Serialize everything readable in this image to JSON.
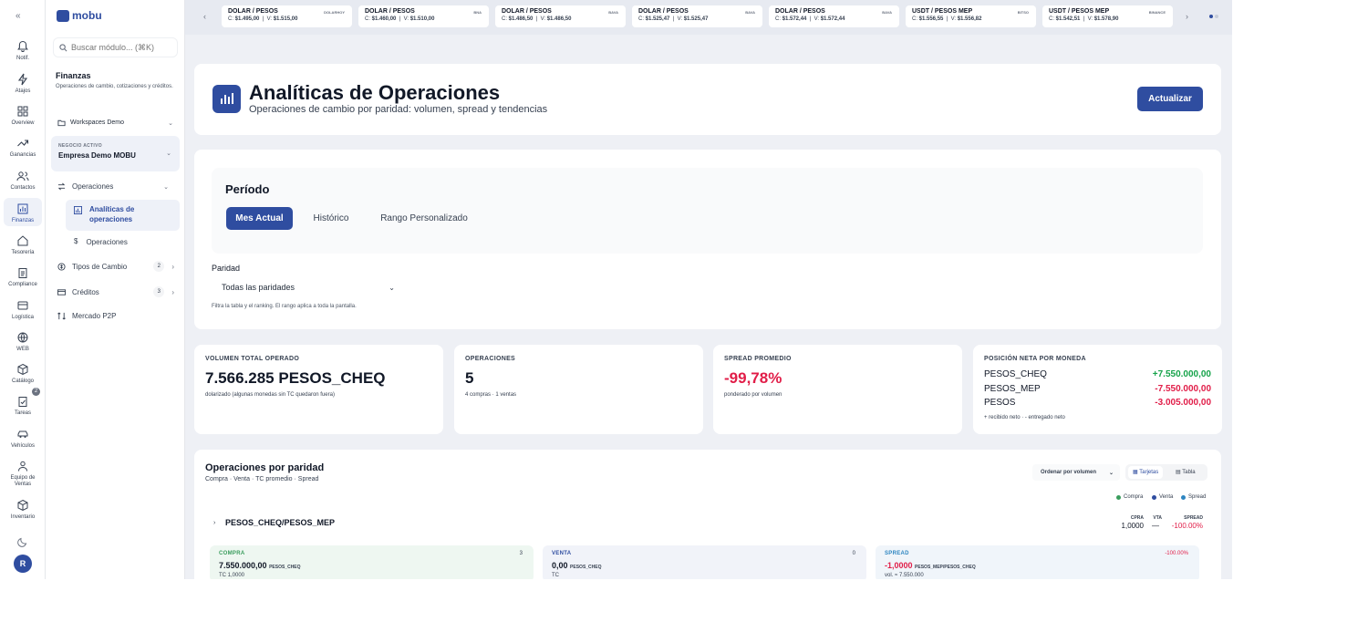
{
  "rail": {
    "collapse_icon": "double-chevron-left-icon",
    "items": [
      {
        "label": "Notif.",
        "icon": "bell-icon"
      },
      {
        "label": "Atajos",
        "icon": "lightning-icon"
      },
      {
        "label": "Overview",
        "icon": "grid-icon"
      },
      {
        "label": "Ganancias",
        "icon": "trend-icon"
      },
      {
        "label": "Contactos",
        "icon": "users-icon"
      },
      {
        "label": "Finanzas",
        "icon": "chart-icon"
      },
      {
        "label": "Tesorería",
        "icon": "home-icon"
      },
      {
        "label": "Compliance",
        "icon": "clipboard-icon"
      },
      {
        "label": "Logística",
        "icon": "box-icon"
      },
      {
        "label": "WEB",
        "icon": "globe-icon"
      },
      {
        "label": "Catálogo",
        "icon": "package-icon",
        "badge": "2"
      },
      {
        "label": "Tareas",
        "icon": "clipboard-check-icon"
      },
      {
        "label": "Vehículos",
        "icon": "car-icon"
      },
      {
        "label": "Equipo de Ventas",
        "icon": "team-icon"
      },
      {
        "label": "Inventario",
        "icon": "cube-icon"
      }
    ],
    "theme_icon": "moon-icon",
    "avatar": "R"
  },
  "sidebar": {
    "logo_text": "mobu",
    "search_placeholder": "Buscar módulo... (⌘K)",
    "section_title": "Finanzas",
    "section_desc": "Operaciones de cambio, cotizaciones y créditos.",
    "workspace": "Workspaces Demo",
    "business_label": "NEGOCIO ACTIVO",
    "business_name": "Empresa Demo MOBU",
    "nav_operaciones": "Operaciones",
    "sub_analiticas": "Analíticas de operaciones",
    "sub_operaciones": "Operaciones",
    "nav_tipos": "Tipos de Cambio",
    "nav_tipos_count": "2",
    "nav_creditos": "Créditos",
    "nav_creditos_count": "3",
    "nav_p2p": "Mercado P2P"
  },
  "ticker": [
    {
      "pair": "DOLAR / PESOS",
      "source": "DOLARHOY",
      "c": "$1.495,00",
      "v": "$1.515,00"
    },
    {
      "pair": "DOLAR / PESOS",
      "source": "BNA",
      "c": "$1.460,00",
      "v": "$1.510,00"
    },
    {
      "pair": "DOLAR / PESOS",
      "source": "BAVA",
      "c": "$1.486,50",
      "v": "$1.486,50"
    },
    {
      "pair": "DOLAR / PESOS",
      "source": "BAVA",
      "c": "$1.525,47",
      "v": "$1.525,47"
    },
    {
      "pair": "DOLAR / PESOS",
      "source": "BAVA",
      "c": "$1.572,44",
      "v": "$1.572,44"
    },
    {
      "pair": "USDT / PESOS MEP",
      "source": "BITSO",
      "c": "$1.556,55",
      "v": "$1.556,82"
    },
    {
      "pair": "USDT / PESOS MEP",
      "source": "BINANCE",
      "c": "$1.542,51",
      "v": "$1.578,90"
    }
  ],
  "header": {
    "title": "Analíticas de Operaciones",
    "subtitle": "Operaciones de cambio por paridad: volumen, spread y tendencias",
    "refresh_label": "Actualizar"
  },
  "filters": {
    "period_label": "Período",
    "periods": [
      "Mes Actual",
      "Histórico",
      "Rango Personalizado"
    ],
    "parity_label": "Paridad",
    "parity_value": "Todas las paridades",
    "note": "Filtra la tabla y el ranking. El rango aplica a toda la pantalla."
  },
  "stats": {
    "volume_label": "VOLUMEN TOTAL OPERADO",
    "volume_value": "7.566.285 PESOS_CHEQ",
    "volume_note": "dolarizado (algunas monedas sin TC quedaron fuera)",
    "ops_label": "OPERACIONES",
    "ops_value": "5",
    "ops_note": "4 compras · 1 ventas",
    "spread_label": "SPREAD PROMEDIO",
    "spread_value": "-99,78%",
    "spread_note": "ponderado por volumen",
    "position_label": "POSICIÓN NETA POR MONEDA",
    "positions": [
      {
        "currency": "PESOS_CHEQ",
        "amount": "+7.550.000,00"
      },
      {
        "currency": "PESOS_MEP",
        "amount": "-7.550.000,00"
      },
      {
        "currency": "PESOS",
        "amount": "-3.005.000,00"
      }
    ],
    "position_legend": "+ recibido neto · - entregado neto"
  },
  "ops": {
    "title": "Operaciones por paridad",
    "subtitle": "Compra · Venta · TC promedio · Spread",
    "sort_label": "Ordenar por volumen",
    "view_cards": "Tarjetas",
    "view_table": "Tabla",
    "legend": [
      "Compra",
      "Venta",
      "Spread"
    ],
    "pair": "PESOS_CHEQ/PESOS_MEP",
    "col_cpra": "CPRA",
    "col_cpra_val": "1,0000",
    "col_vta": "VTA",
    "col_vta_val": "—",
    "col_spread": "SPREAD",
    "col_spread_val": "-100.00%",
    "compra_label": "COMPRA",
    "compra_count": "3",
    "compra_amount": "7.550.000,00",
    "compra_currency": "PESOS_CHEQ",
    "compra_tc": "TC 1,0000",
    "venta_label": "VENTA",
    "venta_count": "0",
    "venta_amount": "0,00",
    "venta_currency": "PESOS_CHEQ",
    "venta_tc": "TC",
    "spread_label": "SPREAD",
    "spread_pct": "-100.00%",
    "spread_amount": "-1,0000",
    "spread_pair": "PESOS_MEP/PESOS_CHEQ",
    "spread_vol": "vol. ≈ 7.550.000"
  },
  "colors": {
    "accent": "#2f4da0",
    "compra": "#3a9d5d",
    "venta": "#2f4da0",
    "spread": "#2e86c1",
    "negative": "#e11d48",
    "positive": "#16a34a"
  }
}
